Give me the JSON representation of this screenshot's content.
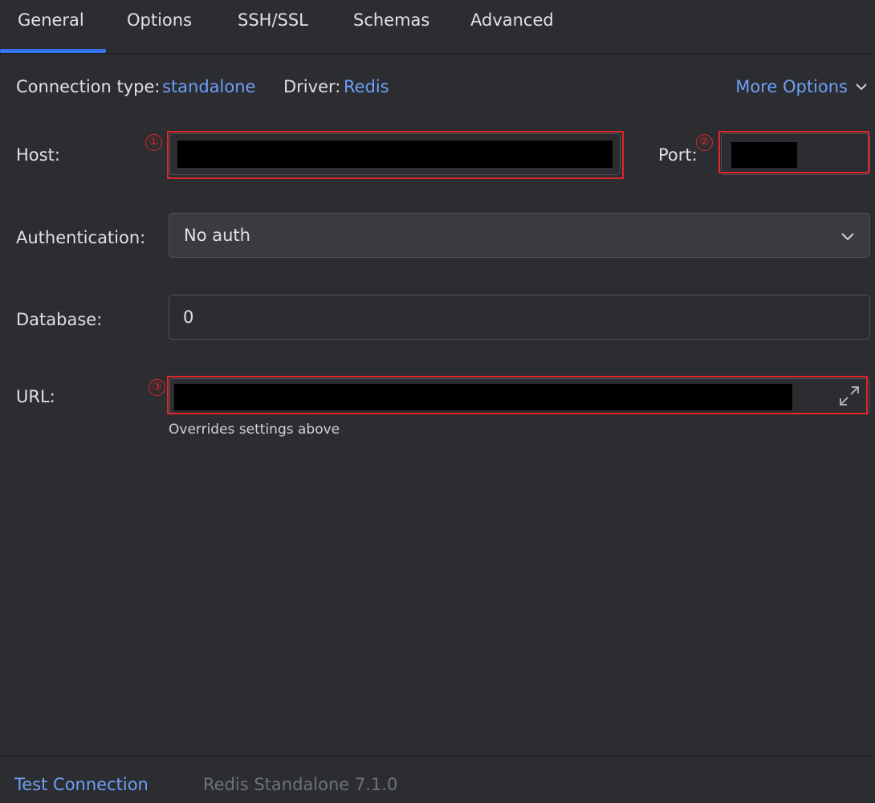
{
  "tabs": [
    {
      "label": "General",
      "active": true
    },
    {
      "label": "Options"
    },
    {
      "label": "SSH/SSL"
    },
    {
      "label": "Schemas"
    },
    {
      "label": "Advanced"
    }
  ],
  "meta": {
    "connection_type_label": "Connection type:",
    "connection_type_value": "standalone",
    "driver_label": "Driver:",
    "driver_value": "Redis",
    "more_options": "More Options"
  },
  "form": {
    "host_label": "Host:",
    "port_label": "Port:",
    "authentication_label": "Authentication:",
    "authentication_value": "No auth",
    "database_label": "Database:",
    "database_value": "0",
    "url_label": "URL:",
    "url_hint": "Overrides settings above"
  },
  "annotations": [
    "①",
    "②",
    "③"
  ],
  "footer": {
    "test_connection": "Test Connection",
    "server_version": "Redis Standalone 7.1.0"
  },
  "colors": {
    "background": "#2b2d30",
    "accent": "#3574f0",
    "link": "#6f9ff8",
    "annotation": "#e0262b"
  },
  "icons": [
    "chevron-down-icon",
    "expand-icon"
  ]
}
